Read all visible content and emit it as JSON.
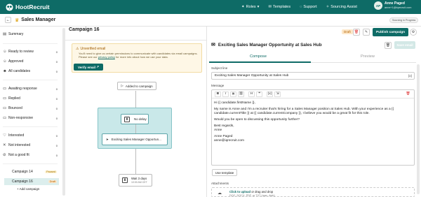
{
  "app": {
    "name": "HootRecruit"
  },
  "nav": {
    "roles": "Roles",
    "templates": "Templates",
    "support": "Support",
    "sourcing_assist": "Sourcing Assist"
  },
  "user": {
    "initials": "AP",
    "name": "Anne Paged",
    "email": "anne+1@iqrecruit.com"
  },
  "sourcing_status": "Sourcing in Progress",
  "role_title": "Sales Manager",
  "sidebar": {
    "items": [
      {
        "label": "Summary",
        "count": ""
      },
      {
        "label": "Ready to review",
        "count": "0"
      },
      {
        "label": "Approved",
        "count": "0"
      },
      {
        "label": "All candidates",
        "count": "0"
      },
      {
        "label": "Awaiting response",
        "count": "0"
      },
      {
        "label": "Replied",
        "count": "0"
      },
      {
        "label": "Bounced",
        "count": "0"
      },
      {
        "label": "Non-responsive",
        "count": "0"
      },
      {
        "label": "Interested",
        "count": "0"
      },
      {
        "label": "Not interested",
        "count": "0"
      },
      {
        "label": "Not a good fit",
        "count": "0"
      }
    ],
    "campaigns": [
      {
        "label": "Campaign 14",
        "status": "Paused"
      },
      {
        "label": "Campaign 16",
        "status": "Draft"
      }
    ],
    "add_campaign": "+ Add campaign"
  },
  "campaign": {
    "title": "Campaign 16",
    "warning_title": "Unverified email",
    "warning_text_1": "You'll need to give us certain permissions to communicate with candidates via email campaigns. Please see our",
    "warning_link": "privacy policy",
    "warning_text_2": "for more info about how we use your data.",
    "verify_button": "Verify email",
    "added_node": "Added to campaign",
    "delay_node": "No delay",
    "email_node": "Exciting Sales Manager Opportun...",
    "wait_node": "Wait 3 days",
    "wait_sub": "10:00 AM CET"
  },
  "editor": {
    "status_badge": "Draft",
    "publish_button": "Publish campaign",
    "email_title": "Exciting Sales Manager Opportunity at Sales Hub",
    "save_button": "Save email",
    "tab_compose": "Compose",
    "tab_preview": "Preview",
    "subject_label": "Subject line",
    "subject_value": "Exciting Sales Manager Opportunity at Sales Hub",
    "subject_token": "{x}",
    "message_label": "Message",
    "toolbar": [
      "B",
      "I",
      "S",
      "⛓",
      "H",
      "❝",
      "{x}",
      "⇲"
    ],
    "body": {
      "greeting": "Hi {{ candidate.firstName }},",
      "p1": "My name is Anne and I'm a recruiter that's hiring for a Sales Manager position at Sales Hub. With your experience as a {{ candidate.currentTitle }} at {{ candidate.currentCompany }}, I believe you would be a great fit for this role.",
      "p2": "Would you be open to discussing this opportunity further?",
      "closing": "Best regards,",
      "sig1": "Anne",
      "sig2": "Anne Paged",
      "sig3": "anne@iqrecruit.com"
    },
    "use_template": "Use template",
    "attachments_label": "Attachments",
    "upload_link": "Click to upload",
    "upload_text": "or drag and drop",
    "upload_formats": "DOC, DOCX, PDF, or TXT (max. 4mb)"
  },
  "colors": {
    "brand": "#0e6b66",
    "sequence_bg": "#c9e8e9",
    "warning_bg": "#fef7e6"
  }
}
